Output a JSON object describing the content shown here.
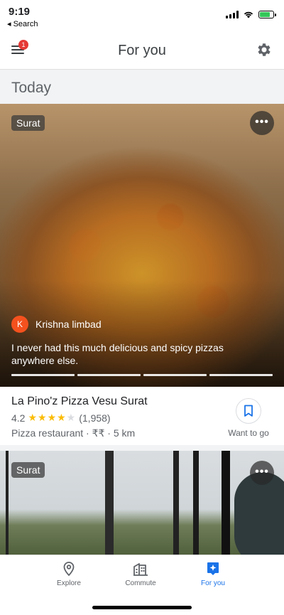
{
  "status_bar": {
    "time": "9:19",
    "back_label": "◂ Search"
  },
  "header": {
    "title": "For you",
    "notification_count": "1"
  },
  "section": {
    "title": "Today"
  },
  "cards": [
    {
      "location_chip": "Surat",
      "more_label": "•••",
      "author_initial": "K",
      "author_name": "Krishna limbad",
      "review": "I never had this much delicious and spicy pizzas anywhere else.",
      "place_name": "La Pino'z Pizza Vesu Surat",
      "rating": "4.2",
      "stars_filled": "★★★★",
      "stars_empty": "★",
      "review_count": "(1,958)",
      "meta": "Pizza restaurant · ₹₹ · 5 km",
      "save_label": "Want to go"
    },
    {
      "location_chip": "Surat",
      "more_label": "•••"
    }
  ],
  "bottom_nav": [
    {
      "label": "Explore",
      "icon": "location-pin-icon",
      "active": false
    },
    {
      "label": "Commute",
      "icon": "commute-icon",
      "active": false
    },
    {
      "label": "For you",
      "icon": "for-you-sparkle-icon",
      "active": true
    }
  ],
  "colors": {
    "accent": "#1a73e8",
    "star": "#fbbc04",
    "badge": "#e53935",
    "avatar": "#f4511e"
  }
}
